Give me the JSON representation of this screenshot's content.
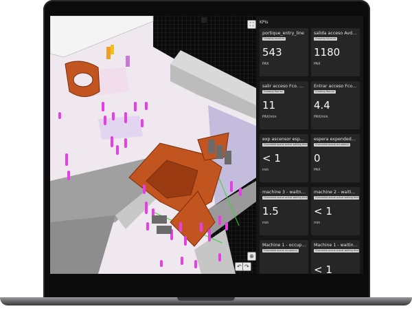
{
  "kpi_panel": {
    "title": "KPIs",
    "cards": [
      {
        "title": "portique_entry_line",
        "badge": "Crossing count ex",
        "value": "543",
        "unit": "PAX"
      },
      {
        "title": "salida acceso Avda. ...",
        "badge": "Crossing count ex",
        "value": "1180",
        "unit": "PAX"
      },
      {
        "title": "salir acceso Fco. Soto",
        "badge": "Crossing flow ex",
        "value": "11",
        "unit": "PAX/min"
      },
      {
        "title": "Entrar acceso Fco. S...",
        "badge": "Crossing flow ex",
        "value": "4.4",
        "unit": "PAX/min"
      },
      {
        "title": "exp ascensor espera",
        "badge": "Channeled queue actual waiting time",
        "value": "< 1",
        "unit": "min"
      },
      {
        "title": "espera expendedora...",
        "badge": "Channeled queue occupancy",
        "value": "0",
        "unit": "PAX"
      },
      {
        "title": "machine 3 - waitng ti...",
        "badge": "Channeled queue actual waiting time",
        "value": "1.5",
        "unit": "min"
      },
      {
        "title": "machine 2 - waiting ti...",
        "badge": "Channeled queue actual waiting time",
        "value": "< 1",
        "unit": "min"
      },
      {
        "title": "Machine 1 - occupancy",
        "badge": "Channeled queue occupancy",
        "value": "",
        "unit": ""
      },
      {
        "title": "Machine 1 - waiting ti...",
        "badge": "Channeled queue actual waiting time",
        "value": "< 1",
        "unit": ""
      }
    ]
  },
  "viewport": {
    "toolbar_top": "expand-icon",
    "bottom_controls": [
      "undo-icon",
      "redo-icon",
      "zoom-icon"
    ]
  },
  "colors": {
    "accent_magenta": "#e83ee6",
    "structure_orange": "#c2541f",
    "wall_grey": "#9a9a9a",
    "panel_bg": "#161616",
    "card_bg": "#262626"
  }
}
